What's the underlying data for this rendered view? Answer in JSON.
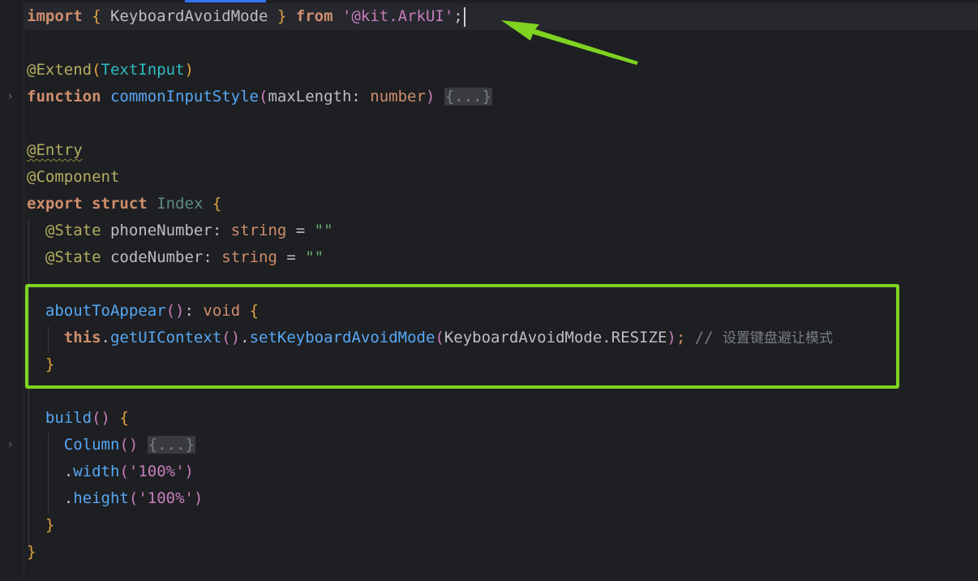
{
  "editor": {
    "code": {
      "line1": {
        "kw_import": "import",
        "brace_open": "{",
        "ident": " KeyboardAvoidMode ",
        "brace_close": "}",
        "kw_from": "from",
        "module": "'@kit.ArkUI'",
        "semicolon": ";"
      },
      "line3": {
        "decorator": "@Extend",
        "paren_open": "(",
        "arg": "TextInput",
        "paren_close": ")"
      },
      "line4": {
        "kw_function": "function",
        "name": "commonInputStyle",
        "paren_open": "(",
        "param": "maxLength",
        "colon": ": ",
        "type": "number",
        "paren_close": ")",
        "folded": "{...}"
      },
      "line6": {
        "decorator": "@Entry"
      },
      "line7": {
        "decorator": "@Component"
      },
      "line8": {
        "kw_export": "export",
        "kw_struct": "struct",
        "name": "Index",
        "brace_open": "{"
      },
      "line9": {
        "decorator": "@State",
        "name": " phoneNumber",
        "colon": ": ",
        "type": "string",
        "assign": " = ",
        "value": "\"\""
      },
      "line10": {
        "decorator": "@State",
        "name": " codeNumber",
        "colon": ": ",
        "type": "string",
        "assign": " = ",
        "value": "\"\""
      },
      "line12": {
        "name": "aboutToAppear",
        "parens": "()",
        "colon": ": ",
        "type": "void",
        "brace_open": "{"
      },
      "line13": {
        "kw_this": "this",
        "dot1": ".",
        "call1": "getUIContext",
        "parens1": "()",
        "dot2": ".",
        "call2": "setKeyboardAvoidMode",
        "paren_open": "(",
        "arg": "KeyboardAvoidMode.RESIZE",
        "paren_close": ")",
        "semicolon": ";",
        "comment_slashes": " // ",
        "comment_text": "设置键盘避让模式"
      },
      "line14": {
        "brace_close": "}"
      },
      "line16": {
        "name": "build",
        "parens": "()",
        "brace_open": "{"
      },
      "line17": {
        "name": "Column",
        "parens": "()",
        "folded": "{...}"
      },
      "line18": {
        "dot": ".",
        "call": "width",
        "paren_open": "(",
        "value": "'100%'",
        "paren_close": ")"
      },
      "line19": {
        "dot": ".",
        "call": "height",
        "paren_open": "(",
        "value": "'100%'",
        "paren_close": ")"
      },
      "line20": {
        "brace_close": "}"
      },
      "line21": {
        "brace_close": "}"
      }
    },
    "gutter": {
      "fold_icon": "›"
    }
  },
  "colors": {
    "background": "#1e1f22",
    "highlight_box": "#7fd321",
    "arrow": "#7fd321",
    "keyword": "#cf8e6d",
    "function": "#56a8f5",
    "string": "#6aab73",
    "annotation": "#b3ae60",
    "comment": "#7a7e85"
  },
  "annotations": {
    "arrow_icon": "arrow-pointing-left-icon",
    "box": "highlight-box"
  }
}
